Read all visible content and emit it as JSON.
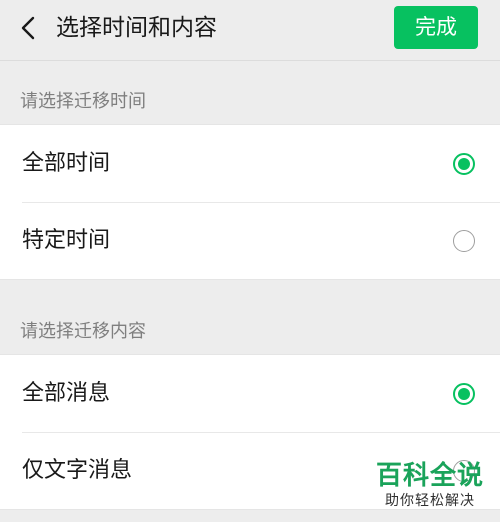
{
  "header": {
    "back_icon": "chevron-left-icon",
    "title": "选择时间和内容",
    "done_label": "完成"
  },
  "colors": {
    "accent": "#07c160",
    "background": "#ededed",
    "card": "#ffffff",
    "section_label": "#7f7f7f"
  },
  "time_section": {
    "label": "请选择迁移时间",
    "options": [
      {
        "label": "全部时间",
        "selected": true
      },
      {
        "label": "特定时间",
        "selected": false
      }
    ]
  },
  "content_section": {
    "label": "请选择迁移内容",
    "options": [
      {
        "label": "全部消息",
        "selected": true
      },
      {
        "label": "仅文字消息",
        "selected": false
      }
    ]
  },
  "watermark": {
    "main": "百科全说",
    "sub": "助你轻松解决"
  }
}
